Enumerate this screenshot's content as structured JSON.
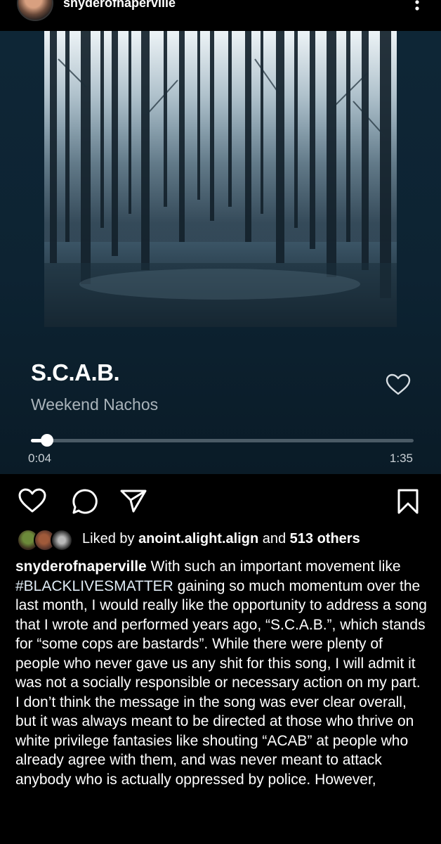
{
  "post": {
    "username": "snyderofnaperville",
    "more_icon": "vertical-dots-icon"
  },
  "player": {
    "song_title": "S.C.A.B.",
    "artist": "Weekend Nachos",
    "elapsed": "0:04",
    "total": "1:35",
    "progress_fraction": 0.042,
    "background_color": "#0e2636"
  },
  "actions": {
    "like_icon": "heart-outline-icon",
    "comment_icon": "comment-bubble-icon",
    "share_icon": "paper-plane-icon",
    "save_icon": "bookmark-icon"
  },
  "likes": {
    "prefix": "Liked by ",
    "first_liker": "anoint.alight.align",
    "middle": " and ",
    "others": "513 others"
  },
  "caption": {
    "username": "snyderofnaperville",
    "text_before_hashtag": " With such an important movement like ",
    "hashtag": "#BLACKLIVESMATTER",
    "text_after_hashtag": " gaining so much momentum over the last month, I would really like the opportunity to address a song that I wrote and performed years ago, “S.C.A.B.”, which stands for “some cops are bastards”. While there were plenty of people who never gave us any shit for this song, I will admit it was not a socially responsible or necessary action on my part. I don’t think the message in the song was ever clear overall, but it was always meant to be directed at those who thrive on white privilege fantasies like shouting “ACAB” at people who already agree with them, and was never meant to attack anybody who is actually oppressed by police. However,"
  }
}
